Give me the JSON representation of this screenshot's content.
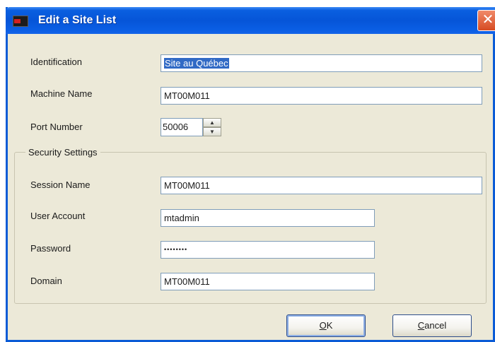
{
  "window": {
    "title": "Edit a Site List",
    "close_glyph": "✕"
  },
  "form": {
    "identification": {
      "label": "Identification",
      "value": "Site au Québec"
    },
    "machine_name": {
      "label": "Machine Name",
      "value": "MT00M011"
    },
    "port_number": {
      "label": "Port Number",
      "value": "50006"
    }
  },
  "security": {
    "group_title": "Security Settings",
    "session_name": {
      "label": "Session Name",
      "value": "MT00M011"
    },
    "user_account": {
      "label": "User Account",
      "value": "mtadmin"
    },
    "password": {
      "label": "Password",
      "value": "••••••••"
    },
    "domain": {
      "label": "Domain",
      "value": "MT00M011"
    }
  },
  "buttons": {
    "ok": {
      "mnemonic": "O",
      "rest": "K"
    },
    "cancel": {
      "mnemonic": "C",
      "rest": "ancel"
    }
  },
  "icons": {
    "app": "app-icon",
    "close": "close-icon",
    "spin_up": "▲",
    "spin_down": "▼"
  },
  "colors": {
    "titlebar": "#0655d8",
    "dialog_bg": "#ece9d8",
    "close_button": "#d64b22",
    "selection": "#316ac5"
  }
}
